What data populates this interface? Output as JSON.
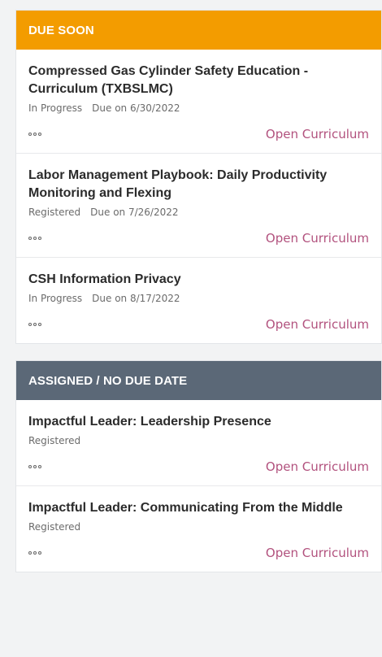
{
  "sections": [
    {
      "header": "DUE SOON",
      "header_color": "#f39c00",
      "items": [
        {
          "title": "Compressed Gas Cylinder Safety Education - Curriculum (TXBSLMC)",
          "status": "In Progress",
          "due": "Due on 6/30/2022",
          "action": "Open Curriculum"
        },
        {
          "title": "Labor Management Playbook: Daily Productivity Monitoring and Flexing",
          "status": "Registered",
          "due": "Due on 7/26/2022",
          "action": "Open Curriculum"
        },
        {
          "title": "CSH Information Privacy",
          "status": "In Progress",
          "due": "Due on 8/17/2022",
          "action": "Open Curriculum"
        }
      ]
    },
    {
      "header": "ASSIGNED / NO DUE DATE",
      "header_color": "#5b6877",
      "items": [
        {
          "title": "Impactful Leader: Leadership Presence",
          "status": "Registered",
          "action": "Open Curriculum"
        },
        {
          "title": "Impactful Leader: Communicating From the Middle",
          "status": "Registered",
          "action": "Open Curriculum"
        }
      ]
    }
  ],
  "colors": {
    "link": "#b2527e",
    "title": "#2b2b2b",
    "meta": "#6b6b6b"
  },
  "icons": {
    "more": "more-options-icon"
  }
}
